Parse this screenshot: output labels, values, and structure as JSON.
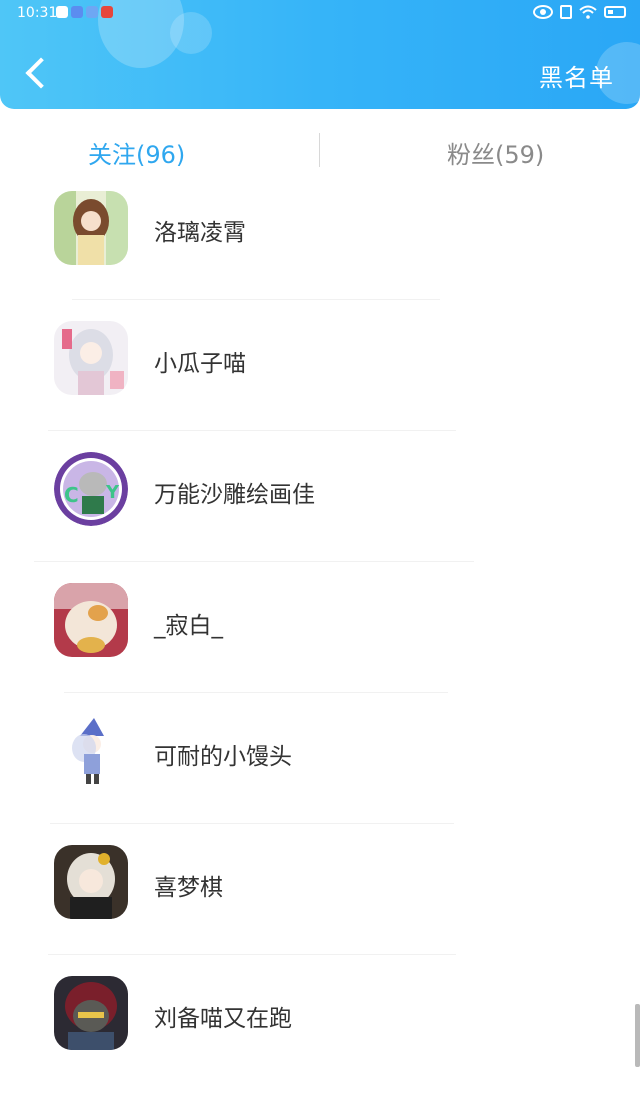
{
  "status_bar": {
    "time": "10:31",
    "app_icons": [
      "wechat-icon",
      "browser-icon",
      "music-icon",
      "study-app-icon"
    ]
  },
  "header": {
    "blacklist_label": "黑名单"
  },
  "tabs": [
    {
      "label": "关注(96)",
      "active": true
    },
    {
      "label": "粉丝(59)",
      "active": false
    }
  ],
  "following": [
    {
      "name": "洛璃凌霄"
    },
    {
      "name": "小瓜子喵"
    },
    {
      "name": "万能沙雕绘画佳"
    },
    {
      "name": "_寂白_"
    },
    {
      "name": "可耐的小馒头"
    },
    {
      "name": "喜梦棋"
    },
    {
      "name": "刘备喵又在跑"
    }
  ],
  "colors": {
    "header_gradient_start": "#4fc6f7",
    "header_gradient_end": "#2aa7f6",
    "active_tab": "#2fa7ef",
    "inactive_tab": "#8a8a8a"
  }
}
